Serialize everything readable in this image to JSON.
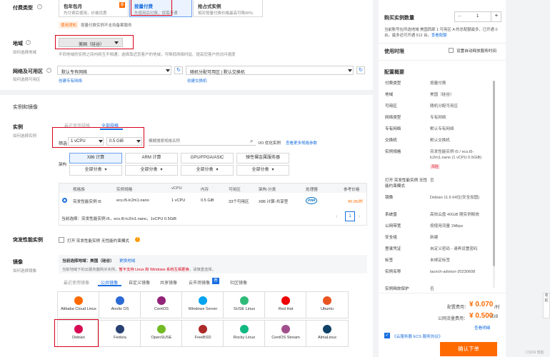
{
  "billing": {
    "label": "付费类型",
    "options": [
      {
        "title": "包年包月",
        "desc": "先付费后使用，价格优惠"
      },
      {
        "title": "按量付费",
        "desc": "先使用后付费，按需开通"
      },
      {
        "title": "抢占式实例",
        "desc": "相对按量付费价格最高可降90%"
      }
    ],
    "discount_tag": "惠",
    "coupon_tag": "使用须知",
    "coupon_text": "按量付费实例不支持备案服务"
  },
  "region": {
    "label": "地域",
    "sub": "如何选择地域",
    "value": "美国（硅谷）",
    "note": "不同地域的实例之间内网互不相通；选择靠近您客户的地域，可降低网络时延、提高您客户的访问速度"
  },
  "network": {
    "label": "网络及可用区",
    "sub": "如何选择可用区",
    "vpc": "默认专有网络",
    "zone": "随机分配可用区 | 默认交换机",
    "vpc_link": "创建专有网络",
    "vsw_link": "创建交换机"
  },
  "section_instance": "实例和镜像",
  "instance": {
    "label": "实例",
    "sub": "如何选择实例",
    "tabs": [
      "最近使用规格",
      "全部规格"
    ],
    "filter_label": "筛选",
    "vcpu": "1 vCPU",
    "mem": "0.5 GiB",
    "search_placeholder": "模糊搜索规格名称",
    "io_opt": "I/O 优化实例",
    "more_link": "查看更多规格参数",
    "arch_label": "架构",
    "arch_tabs": [
      "X86 计算",
      "ARM 计算",
      "GPU/FPGA/ASIC",
      "弹性裸金属服务器"
    ],
    "arch_all": "全部分类",
    "table_headers": [
      "规格族",
      "实例规格",
      "vCPU",
      "内存",
      "可用区",
      "架构-分类",
      "处理器",
      "参考价格"
    ],
    "row": [
      "突发性能实例 t5",
      "ecs.t5-lc2m1.nano",
      "1 vCPU",
      "0.5 GiB",
      "33个可用区",
      "X86 计算-共享型",
      "intel",
      "¥0.05/时"
    ],
    "current": "当前选择：突发性能实例 t5，ecs.t5-lc2m1.nano，1vCPU 0.5GiB",
    "page": "1"
  },
  "burst": {
    "label": "突发性能实例",
    "text": "打开 突发性能实例 无性能约束模式"
  },
  "image": {
    "label": "镜像",
    "sub": "如何选择镜像",
    "current": "当前选择地域：美国（硅谷）",
    "view_region": "更换地域",
    "note": "当前地域下的云服务器购买实例，",
    "note_red": "暂不支持 Linux 和 Windows 系统互相更换",
    "note_end": "，请慎重选择。",
    "tabs": [
      "最近使用镜像",
      "公共镜像",
      "自定义镜像",
      "共享镜像",
      "云市场镜像",
      "社区镜像"
    ],
    "os": [
      {
        "name": "Alibaba Cloud Linux",
        "color": "#ff6a00"
      },
      {
        "name": "Anolis OS",
        "color": "#2a6ad4"
      },
      {
        "name": "CentOS",
        "color": "#932279"
      },
      {
        "name": "Windows Server",
        "color": "#00a4ef"
      },
      {
        "name": "SUSE Linux",
        "color": "#30ba78"
      },
      {
        "name": "Red Hat",
        "color": "#ee0000"
      },
      {
        "name": "Ubuntu",
        "color": "#e95420"
      },
      {
        "name": "Debian",
        "color": "#d70a53"
      },
      {
        "name": "Fedora",
        "color": "#294172"
      },
      {
        "name": "OpenSUSE",
        "color": "#73ba25"
      },
      {
        "name": "FreeBSD",
        "color": "#ab2b28"
      },
      {
        "name": "Rocky Linux",
        "color": "#10b981"
      },
      {
        "name": "CentOS Stream",
        "color": "#a14f8c"
      },
      {
        "name": "AlmaLinux",
        "color": "#0f4266"
      }
    ],
    "ver_select": "选择版本"
  },
  "side": {
    "qty_label": "购买实例数量",
    "qty": "1",
    "qty_note": "当前账号在所选地域 美国西部 1 可用区 A 的总配额最多，已开通 0 台，最多还可开通 512 台。",
    "quota_link": "查看配额",
    "duration_label": "使用时限",
    "auto_release": "设置自动释放服务时间",
    "summary_title": "配置概要",
    "rows": [
      [
        "付费类型",
        "按量付费"
      ],
      [
        "地域",
        "美国（硅谷）"
      ],
      [
        "可用区",
        "随机分配可用区"
      ],
      [
        "网络类型",
        "专有网络"
      ],
      [
        "专有网络",
        "默认专有网络"
      ],
      [
        "交换机",
        "默认交换机"
      ],
      [
        "实例规格",
        "突发性能实例 t5 / ecs.t5-lc2m1.nano (1 vCPU 0.5GiB)"
      ],
      [
        "打开 突发性能实例 无性能约束模式",
        "否"
      ],
      [
        "镜像",
        "Debian 11.6 64位(安全加固)"
      ],
      [
        "系统盘",
        "高效云盘 40GiB 随实例释放"
      ],
      [
        "公网带宽",
        "按使用流量 1Mbps"
      ],
      [
        "安全组",
        "新建"
      ],
      [
        "登录凭证",
        "自定义密码 - 请再设置密码"
      ],
      [
        "标签",
        "未绑定标签"
      ],
      [
        "实例名称",
        "launch-advisor-20230608"
      ],
      [
        "实例释放保护",
        "否"
      ]
    ],
    "risk_tag": "风险",
    "fee_label": "配置费用：",
    "fee": "¥ 0.070",
    "fee_unit": "/时",
    "traffic_label": "公网流量费用：",
    "traffic": "¥ 0.500",
    "traffic_unit": "/GB",
    "detail_link": "查看明细",
    "agree": "《云服务器 ECS 服务协议》",
    "order_button": "确认下单",
    "watermark": "CSDN 博客",
    "collapse": "收起"
  }
}
